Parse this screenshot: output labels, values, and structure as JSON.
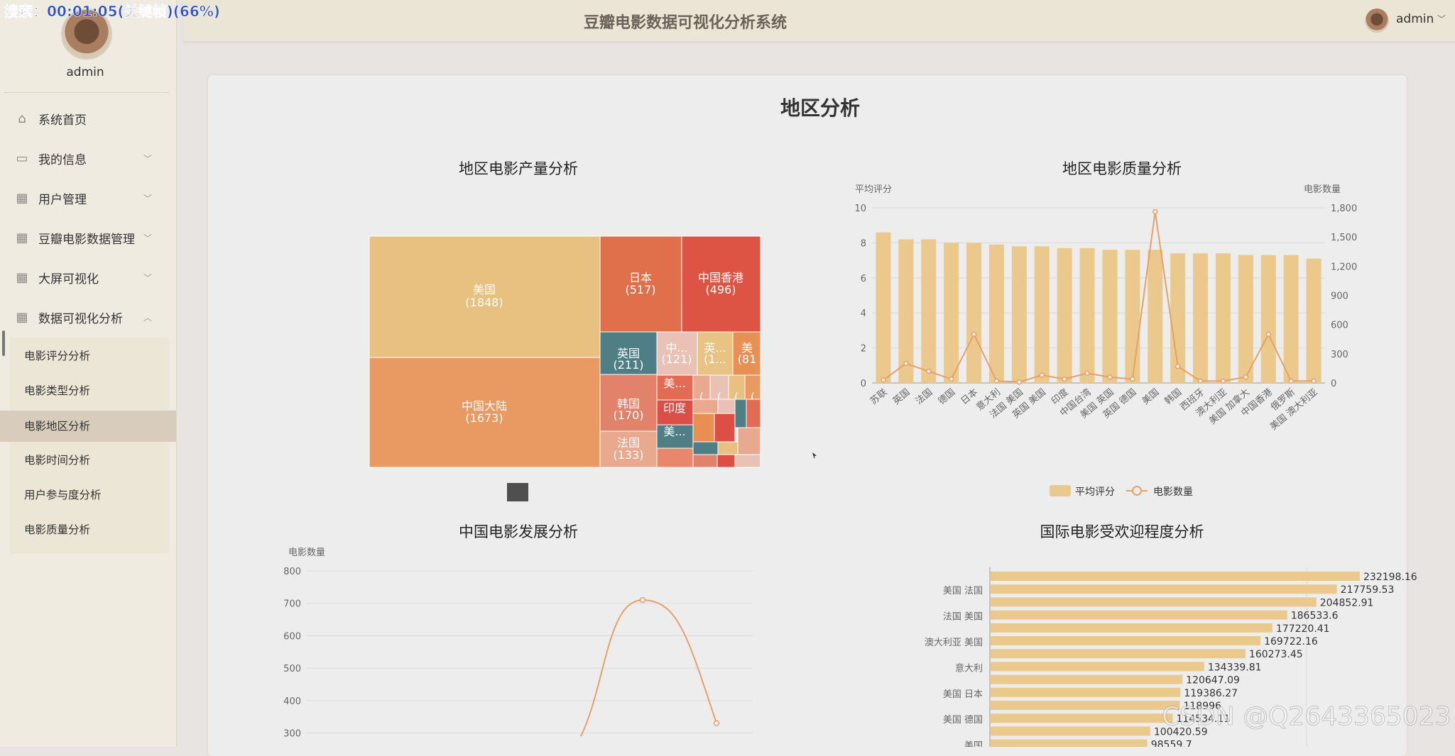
{
  "overlay": {
    "text": "搜索：00:01:05(关键帧)(66%)"
  },
  "sidebar": {
    "username": "admin",
    "menu": [
      {
        "label": "系统首页",
        "icon": "home-icon",
        "chev": ""
      },
      {
        "label": "我的信息",
        "icon": "id-card-icon",
        "chev": "﹀"
      },
      {
        "label": "用户管理",
        "icon": "grid-icon",
        "chev": "﹀"
      },
      {
        "label": "豆瓣电影数据管理",
        "icon": "grid-icon",
        "chev": "﹀"
      },
      {
        "label": "大屏可视化",
        "icon": "grid-icon",
        "chev": "﹀"
      },
      {
        "label": "数据可视化分析",
        "icon": "grid-icon",
        "chev": "︿"
      }
    ],
    "submenu": [
      {
        "label": "电影评分分析"
      },
      {
        "label": "电影类型分析"
      },
      {
        "label": "电影地区分析",
        "active": true
      },
      {
        "label": "电影时间分析"
      },
      {
        "label": "用户参与度分析"
      },
      {
        "label": "电影质量分析"
      }
    ]
  },
  "header": {
    "title": "豆瓣电影数据可视化分析系统",
    "username": "admin",
    "chevron": "﹀"
  },
  "page": {
    "title": "地区分析"
  },
  "charts": {
    "treemap": {
      "title": "地区电影产量分析",
      "items": [
        {
          "label": "美国",
          "value_text": "(1848)",
          "color": "#e8c07f"
        },
        {
          "label": "中国大陆",
          "value_text": "(1673)",
          "color": "#e89a62"
        },
        {
          "label": "日本",
          "value_text": "(517)",
          "color": "#e0704c"
        },
        {
          "label": "中国香港",
          "value_text": "(496)",
          "color": "#de5444"
        },
        {
          "label": "英国",
          "value_text": "(211)",
          "color": "#4e7f86"
        },
        {
          "label": "韩国",
          "value_text": "(170)",
          "color": "#e2826a"
        },
        {
          "label": "法国",
          "value_text": "(133)",
          "color": "#e9a98f"
        },
        {
          "label": "中...",
          "value_text": "(121)",
          "color": "#eac2b5"
        },
        {
          "label": "英...",
          "value_text": "(1...",
          "color": "#e9c383"
        },
        {
          "label": "美",
          "value_text": "(81",
          "color": "#e88f54"
        },
        {
          "label": "美...",
          "value_text": "",
          "color": "#e46b53"
        },
        {
          "label": "印度",
          "value_text": "",
          "color": "#dc4f47"
        },
        {
          "label": "美...",
          "value_text": "",
          "color": "#4e7f86"
        },
        {
          "label": "(",
          "value_text": "",
          "color": "#e9a98f"
        },
        {
          "label": "(",
          "value_text": "",
          "color": "#eac2b5"
        },
        {
          "label": "(",
          "value_text": "",
          "color": "#e8c07f"
        },
        {
          "label": "(",
          "value_text": "",
          "color": "#e89a62"
        }
      ],
      "legend_box_color": "#4f4f4f"
    },
    "quality": {
      "title": "地区电影质量分析",
      "y_left_label": "平均评分",
      "y_right_label": "电影数量",
      "y_left_ticks": [
        "0",
        "2",
        "4",
        "6",
        "8",
        "10"
      ],
      "y_right_ticks": [
        "0",
        "300",
        "600",
        "900",
        "1,200",
        "1,500",
        "1,800"
      ],
      "legend": [
        {
          "label": "平均评分",
          "color": "#ebc88c"
        },
        {
          "label": "电影数量",
          "color": "#e8a06a"
        }
      ]
    },
    "china": {
      "title": "中国电影发展分析",
      "y_label": "电影数量",
      "y_ticks": [
        "300",
        "400",
        "500",
        "600",
        "700",
        "800"
      ]
    },
    "intl": {
      "title": "国际电影受欢迎程度分析",
      "y_cats": [
        "美国 法国",
        "法国 美国",
        "澳大利亚 美国",
        "意大利",
        "美国 日本",
        "美国 德国",
        "美国"
      ]
    }
  },
  "chart_data": [
    {
      "type": "bar",
      "title": "地区电影质量分析",
      "ylabel": "平均评分",
      "ylabel_right": "电影数量",
      "ylim": [
        0,
        10
      ],
      "ylim_right": [
        0,
        1800
      ],
      "categories": [
        "苏联",
        "英国",
        "法国",
        "德国",
        "日本",
        "意大利",
        "法国 美国",
        "英国 美国",
        "印度",
        "中国台湾",
        "美国 英国",
        "英国 德国",
        "美国",
        "韩国",
        "西班牙",
        "澳大利亚",
        "美国 加拿大",
        "中国香港",
        "俄罗斯",
        "美国 澳大利亚"
      ],
      "series": [
        {
          "name": "平均评分",
          "type": "bar",
          "values": [
            8.6,
            8.2,
            8.2,
            8.0,
            8.0,
            7.9,
            7.8,
            7.8,
            7.7,
            7.7,
            7.6,
            7.6,
            7.6,
            7.4,
            7.4,
            7.4,
            7.3,
            7.3,
            7.3,
            7.1
          ]
        },
        {
          "name": "电影数量",
          "type": "line",
          "values": [
            30,
            200,
            120,
            40,
            500,
            20,
            10,
            80,
            40,
            100,
            60,
            40,
            1760,
            170,
            20,
            20,
            60,
            500,
            20,
            20
          ]
        }
      ],
      "legend": "bottom"
    },
    {
      "type": "line",
      "title": "中国电影发展分析",
      "ylabel": "电影数量",
      "ylim": [
        300,
        800
      ],
      "series": [
        {
          "name": "电影数量",
          "values": [
            250,
            290,
            710,
            330
          ]
        }
      ]
    },
    {
      "type": "bar",
      "orientation": "horizontal",
      "title": "国际电影受欢迎程度分析",
      "categories": [
        "",
        "美国 法国",
        "",
        "法国 美国",
        "",
        "澳大利亚 美国",
        "",
        "意大利",
        "",
        "美国 日本",
        "",
        "美国 德国",
        "",
        "美国"
      ],
      "values": [
        232198.16,
        217759.53,
        204852.91,
        186533.6,
        177220.41,
        169722.16,
        160273.45,
        134339.81,
        120647.09,
        119386.27,
        118996,
        114534.11,
        100420.59,
        98559.7
      ],
      "value_labels": [
        "232198.16",
        "217759.53",
        "204852.91",
        "186533.6",
        "177220.41",
        "169722.16",
        "160273.45",
        "134339.81",
        "120647.09",
        "119386.27",
        "118996",
        "114534.11",
        "100420.59",
        "98559.7"
      ]
    }
  ],
  "watermark": "CSDN @Q2643365023"
}
